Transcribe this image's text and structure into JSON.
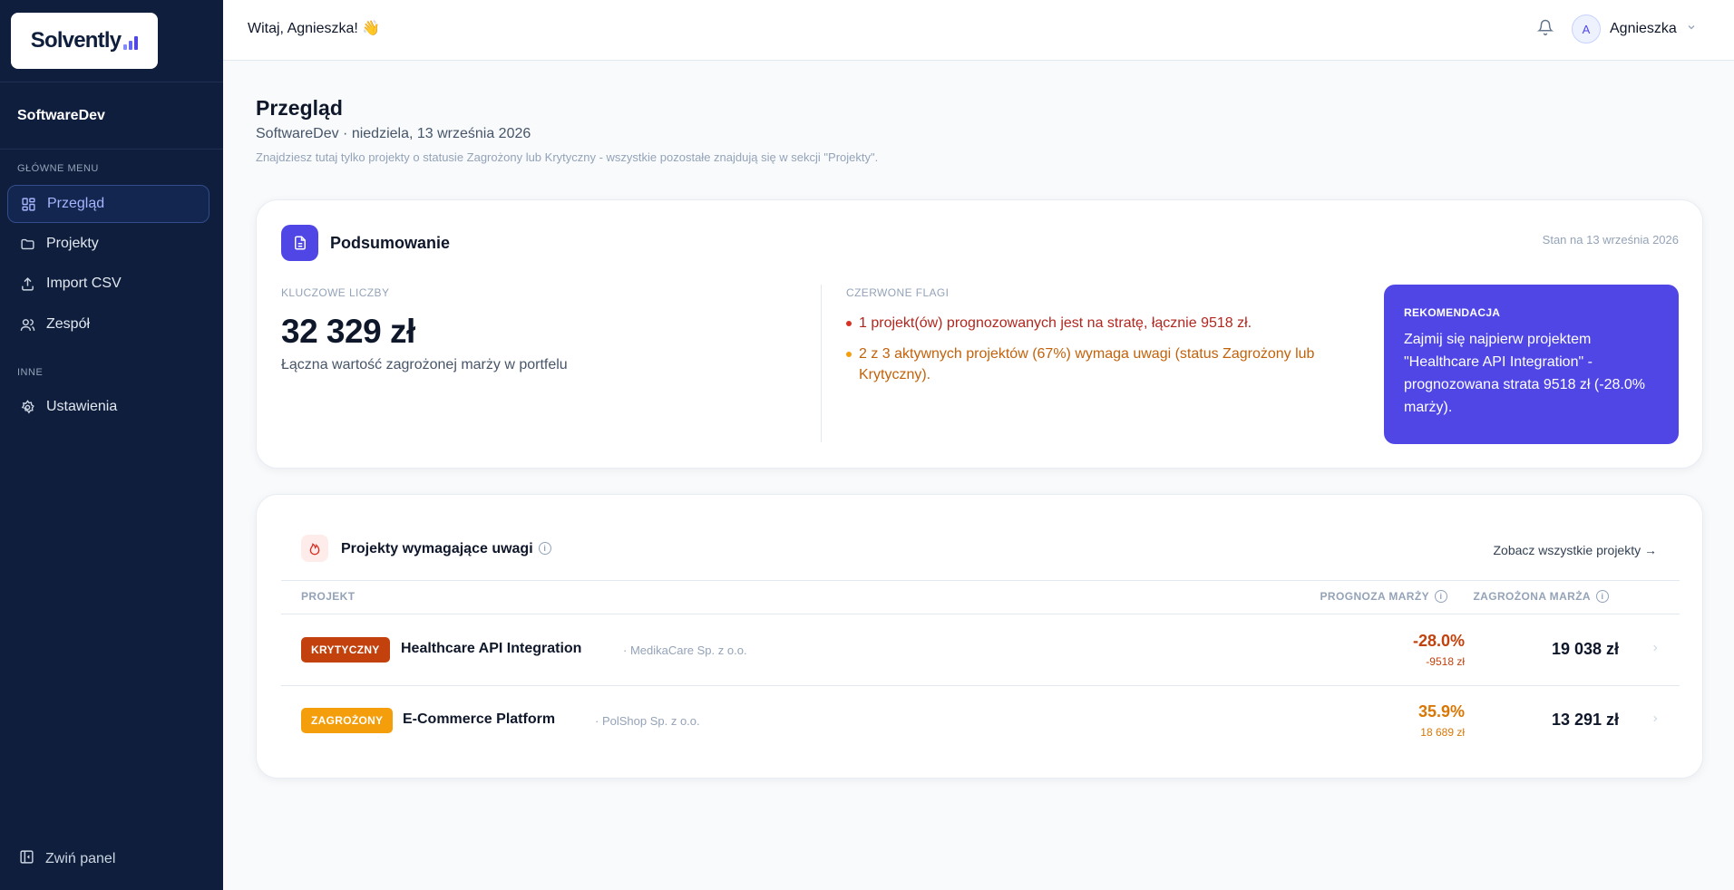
{
  "brand": {
    "name": "Solvently"
  },
  "sidebar": {
    "workspace": "SoftwareDev",
    "main_section": "GŁÓWNE MENU",
    "items": [
      {
        "label": "Przegląd",
        "icon": "grid-icon"
      },
      {
        "label": "Projekty",
        "icon": "folder-icon"
      },
      {
        "label": "Import CSV",
        "icon": "upload-icon"
      },
      {
        "label": "Zespół",
        "icon": "users-icon"
      }
    ],
    "other_section": "INNE",
    "other_items": [
      {
        "label": "Ustawienia",
        "icon": "gear-icon"
      }
    ],
    "collapse_label": "Zwiń panel"
  },
  "header": {
    "greeting": "Witaj, Agnieszka! 👋",
    "user_initial": "A",
    "user_name": "Agnieszka"
  },
  "page": {
    "title": "Przegląd",
    "subtitle": "SoftwareDev · niedziela, 13 września 2026",
    "note": "Znajdziesz tutaj tylko projekty o statusie Zagrożony lub Krytyczny - wszystkie pozostałe znajdują się w sekcji \"Projekty\"."
  },
  "summary": {
    "title": "Podsumowanie",
    "as_of": "Stan na 13 września 2026",
    "key_label": "KLUCZOWE LICZBY",
    "key_value": "32 329 zł",
    "key_desc": "Łączna wartość zagrożonej marży w portfelu",
    "flags_label": "CZERWONE FLAGI",
    "flags": [
      {
        "text": "1 projekt(ów) prognozowanych jest na stratę, łącznie 9518 zł.",
        "severity": "red"
      },
      {
        "text": "2 z 3 aktywnych projektów (67%) wymaga uwagi (status Zagrożony lub Krytyczny).",
        "severity": "amber"
      }
    ],
    "reco_label": "REKOMENDACJA",
    "reco_text": "Zajmij się najpierw projektem \"Healthcare API Integration\" - prognozowana strata 9518 zł (-28.0% marży)."
  },
  "projects": {
    "title": "Projekty wymagające uwagi",
    "see_all": "Zobacz wszystkie projekty →",
    "columns": {
      "project": "PROJEKT",
      "forecast": "PROGNOZA MARŻY",
      "at_risk": "ZAGROŻONA MARŻA"
    },
    "rows": [
      {
        "status": "KRYTYCZNY",
        "name": "Healthcare API Integration",
        "client": "· MedikaCare Sp. z o.o.",
        "margin_pct": "-28.0%",
        "margin_amt": "-9518 zł",
        "at_risk": "19 038 zł"
      },
      {
        "status": "ZAGROŻONY",
        "name": "E-Commerce Platform",
        "client": "· PolShop Sp. z o.o.",
        "margin_pct": "35.9%",
        "margin_amt": "18 689 zł",
        "at_risk": "13 291 zł"
      }
    ]
  },
  "colors": {
    "sidebar": "#0f1e3d",
    "accent": "#4f46e5",
    "critical": "#c2410c",
    "warning": "#f59e0b"
  }
}
